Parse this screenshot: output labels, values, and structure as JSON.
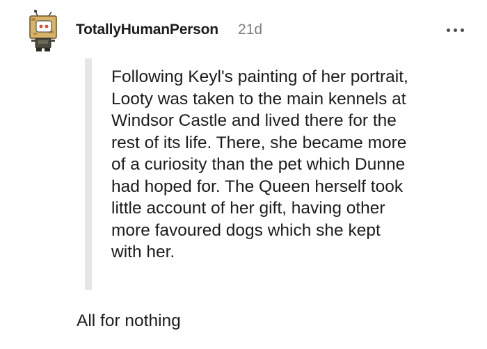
{
  "comment": {
    "author": "TotallyHumanPerson",
    "age": "21d",
    "menu_icon": "more-dots-icon",
    "avatar_icon": "robot-avatar-icon",
    "quote_lines": [
      "Following Keyl's painting of her portrait,",
      "Looty was taken to the main kennels at",
      "Windsor Castle and lived there for the",
      "rest of its life. There, she became more",
      "of a curiosity than the pet which Dunne",
      "had hoped for. The Queen herself took",
      "little account of her gift, having other",
      "more favoured dogs which she kept",
      "with her."
    ],
    "reply": "All for nothing"
  },
  "colors": {
    "text": "#1c1c1c",
    "meta": "#7c7c7c",
    "quote_bar": "#e6e6e6",
    "avatar_box": "#d8b46a"
  }
}
